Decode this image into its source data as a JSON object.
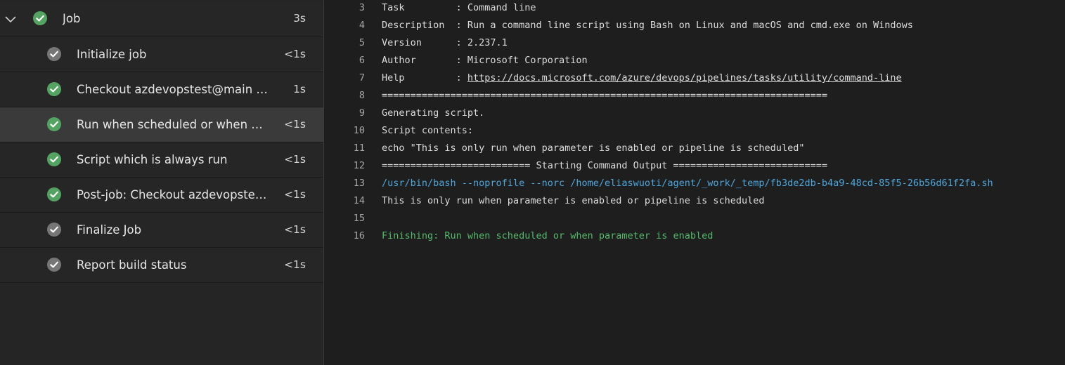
{
  "colors": {
    "success": "#55a362",
    "neutral": "#767676",
    "command": "#4ea6dc",
    "finishing": "#55b86a"
  },
  "job": {
    "title": "Job",
    "duration": "3s",
    "status_icon": "check-circle-icon"
  },
  "steps": [
    {
      "label": "Initialize job",
      "duration": "<1s",
      "status": "neutral"
    },
    {
      "label": "Checkout azdevopstest@main to s",
      "duration": "1s",
      "status": "success"
    },
    {
      "label": "Run when scheduled or when pa...",
      "duration": "<1s",
      "status": "success",
      "selected": true
    },
    {
      "label": "Script which is always run",
      "duration": "<1s",
      "status": "success"
    },
    {
      "label": "Post-job: Checkout azdevopstest...",
      "duration": "<1s",
      "status": "success"
    },
    {
      "label": "Finalize Job",
      "duration": "<1s",
      "status": "neutral"
    },
    {
      "label": "Report build status",
      "duration": "<1s",
      "status": "neutral"
    }
  ],
  "log": {
    "lines": [
      {
        "n": "3",
        "text": "Task         : Command line"
      },
      {
        "n": "4",
        "text": "Description  : Run a command line script using Bash on Linux and macOS and cmd.exe on Windows"
      },
      {
        "n": "5",
        "text": "Version      : 2.237.1"
      },
      {
        "n": "6",
        "text": "Author       : Microsoft Corporation"
      },
      {
        "n": "7",
        "prefix": "Help         : ",
        "link": "https://docs.microsoft.com/azure/devops/pipelines/tasks/utility/command-line"
      },
      {
        "n": "8",
        "text": "=============================================================================="
      },
      {
        "n": "9",
        "text": "Generating script."
      },
      {
        "n": "10",
        "text": "Script contents:"
      },
      {
        "n": "11",
        "text": "echo \"This is only run when parameter is enabled or pipeline is scheduled\""
      },
      {
        "n": "12",
        "text": "========================== Starting Command Output ==========================="
      },
      {
        "n": "13",
        "text": "/usr/bin/bash --noprofile --norc /home/eliaswuoti/agent/_work/_temp/fb3de2db-b4a9-48cd-85f5-26b56d61f2fa.sh",
        "kind": "cmd"
      },
      {
        "n": "14",
        "text": "This is only run when parameter is enabled or pipeline is scheduled"
      },
      {
        "n": "15",
        "text": ""
      },
      {
        "n": "16",
        "text": "Finishing: Run when scheduled or when parameter is enabled",
        "kind": "fin"
      }
    ]
  }
}
